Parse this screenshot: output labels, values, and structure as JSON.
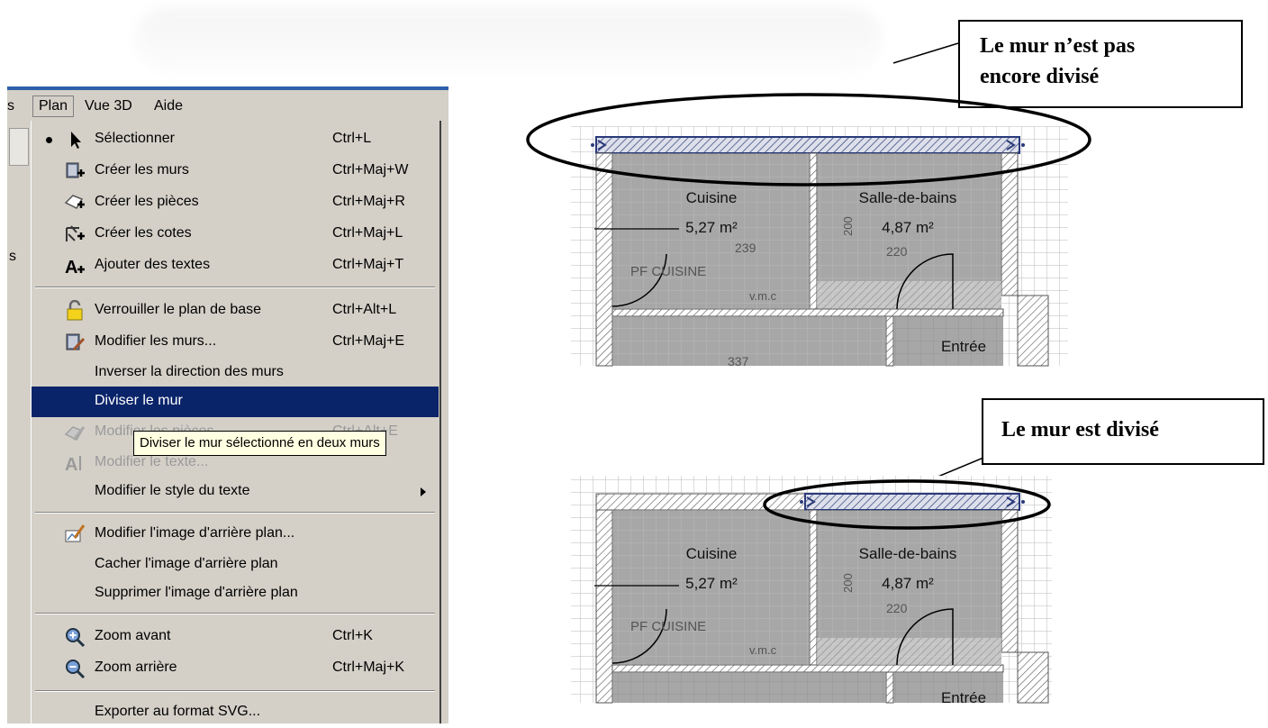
{
  "menubar": {
    "items": [
      {
        "label": "s"
      },
      {
        "label": "Plan"
      },
      {
        "label": "Vue 3D"
      },
      {
        "label": "Aide"
      }
    ]
  },
  "left_strip_label": "s",
  "menu": {
    "items": [
      {
        "label": "Sélectionner",
        "shortcut": "Ctrl+L",
        "icon": "cursor-arrow-icon"
      },
      {
        "label": "Créer les murs",
        "shortcut": "Ctrl+Maj+W",
        "icon": "create-walls-icon"
      },
      {
        "label": "Créer les pièces",
        "shortcut": "Ctrl+Maj+R",
        "icon": "create-rooms-icon"
      },
      {
        "label": "Créer les cotes",
        "shortcut": "Ctrl+Maj+L",
        "icon": "create-dimensions-icon"
      },
      {
        "label": "Ajouter des textes",
        "shortcut": "Ctrl+Maj+T",
        "icon": "add-text-icon"
      },
      {
        "label": "Verrouiller le plan de base",
        "shortcut": "Ctrl+Alt+L",
        "icon": "lock-plan-icon"
      },
      {
        "label": "Modifier les murs...",
        "shortcut": "Ctrl+Maj+E",
        "icon": "modify-walls-icon"
      },
      {
        "label": "Inverser la direction des murs",
        "shortcut": ""
      },
      {
        "label": "Diviser le mur",
        "shortcut": ""
      },
      {
        "label": "Modifier les pièces...",
        "shortcut": "Ctrl+Alt+E",
        "icon": "modify-rooms-icon"
      },
      {
        "label": "Modifier le texte...",
        "shortcut": "",
        "icon": "modify-text-icon"
      },
      {
        "label": "Modifier le style du texte",
        "shortcut": ""
      },
      {
        "label": "Modifier l'image d'arrière plan...",
        "shortcut": "",
        "icon": "background-image-icon"
      },
      {
        "label": "Cacher l'image d'arrière plan",
        "shortcut": ""
      },
      {
        "label": "Supprimer l'image d'arrière plan",
        "shortcut": ""
      },
      {
        "label": "Zoom avant",
        "shortcut": "Ctrl+K",
        "icon": "zoom-in-icon"
      },
      {
        "label": "Zoom arrière",
        "shortcut": "Ctrl+Maj+K",
        "icon": "zoom-out-icon"
      },
      {
        "label": "Exporter au format SVG...",
        "shortcut": ""
      }
    ]
  },
  "tooltip": "Diviser le mur sélectionné en deux murs",
  "callouts": {
    "top_line1": "Le mur n’est pas",
    "top_line2": "encore divisé",
    "bottom": "Le mur est divisé"
  },
  "plans": {
    "room1_name": "Cuisine",
    "room1_area": "5,27 m²",
    "room2_name": "Salle-de-bains",
    "room2_area": "4,87 m²",
    "room3_name": "Entrée",
    "furniture1": "PF CUISINE",
    "label_vmc": "v.m.c",
    "dim_239": "239",
    "dim_220": "220",
    "dim_200": "200",
    "dim_337": "337"
  },
  "colors": {
    "menu_bg": "#d4d0c8",
    "highlight": "#0a246a",
    "tooltip_bg": "#ffffe1",
    "wall_selected": "#2a3a7a"
  }
}
